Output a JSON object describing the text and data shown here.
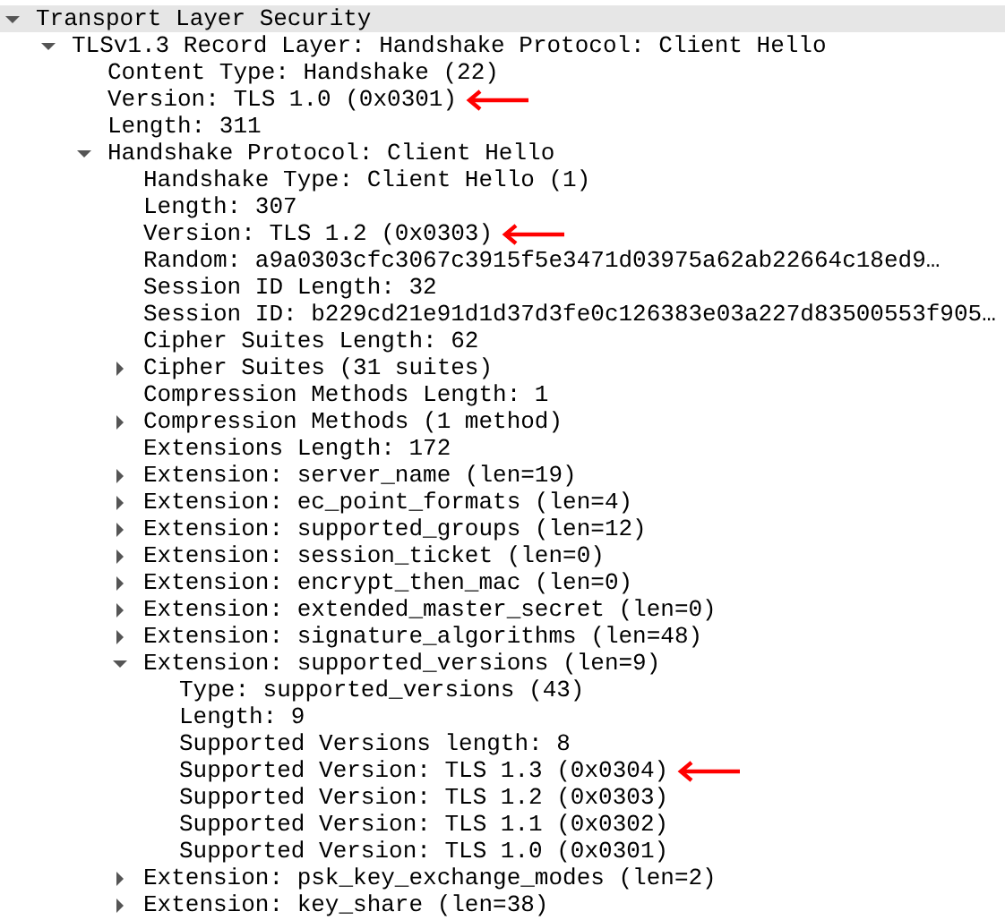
{
  "tree": [
    {
      "label": "Transport Layer Security",
      "selected": true,
      "marked": false,
      "expanded": true,
      "children": [
        {
          "label": "TLSv1.3 Record Layer: Handshake Protocol: Client Hello",
          "selected": false,
          "marked": false,
          "expanded": true,
          "children": [
            {
              "label": "Content Type: Handshake (22)",
              "selected": false,
              "marked": false
            },
            {
              "label": "Version: TLS 1.0 (0x0301)",
              "selected": false,
              "marked": true
            },
            {
              "label": "Length: 311",
              "selected": false,
              "marked": false
            },
            {
              "label": "Handshake Protocol: Client Hello",
              "selected": false,
              "marked": false,
              "expanded": true,
              "children": [
                {
                  "label": "Handshake Type: Client Hello (1)",
                  "selected": false,
                  "marked": false
                },
                {
                  "label": "Length: 307",
                  "selected": false,
                  "marked": false
                },
                {
                  "label": "Version: TLS 1.2 (0x0303)",
                  "selected": false,
                  "marked": true
                },
                {
                  "label": "Random: a9a0303cfc3067c3915f5e3471d03975a62ab22664c18ed9…",
                  "selected": false,
                  "marked": false
                },
                {
                  "label": "Session ID Length: 32",
                  "selected": false,
                  "marked": false
                },
                {
                  "label": "Session ID: b229cd21e91d1d37d3fe0c126383e03a227d83500553f905…",
                  "selected": false,
                  "marked": false
                },
                {
                  "label": "Cipher Suites Length: 62",
                  "selected": false,
                  "marked": false
                },
                {
                  "label": "Cipher Suites (31 suites)",
                  "selected": false,
                  "marked": false,
                  "expanded": false
                },
                {
                  "label": "Compression Methods Length: 1",
                  "selected": false,
                  "marked": false
                },
                {
                  "label": "Compression Methods (1 method)",
                  "selected": false,
                  "marked": false,
                  "expanded": false
                },
                {
                  "label": "Extensions Length: 172",
                  "selected": false,
                  "marked": false
                },
                {
                  "label": "Extension: server_name (len=19)",
                  "selected": false,
                  "marked": false,
                  "expanded": false
                },
                {
                  "label": "Extension: ec_point_formats (len=4)",
                  "selected": false,
                  "marked": false,
                  "expanded": false
                },
                {
                  "label": "Extension: supported_groups (len=12)",
                  "selected": false,
                  "marked": false,
                  "expanded": false
                },
                {
                  "label": "Extension: session_ticket (len=0)",
                  "selected": false,
                  "marked": false,
                  "expanded": false
                },
                {
                  "label": "Extension: encrypt_then_mac (len=0)",
                  "selected": false,
                  "marked": false,
                  "expanded": false
                },
                {
                  "label": "Extension: extended_master_secret (len=0)",
                  "selected": false,
                  "marked": false,
                  "expanded": false
                },
                {
                  "label": "Extension: signature_algorithms (len=48)",
                  "selected": false,
                  "marked": false,
                  "expanded": false
                },
                {
                  "label": "Extension: supported_versions (len=9)",
                  "selected": false,
                  "marked": false,
                  "expanded": true,
                  "children": [
                    {
                      "label": "Type: supported_versions (43)",
                      "selected": false,
                      "marked": false
                    },
                    {
                      "label": "Length: 9",
                      "selected": false,
                      "marked": false
                    },
                    {
                      "label": "Supported Versions length: 8",
                      "selected": false,
                      "marked": false
                    },
                    {
                      "label": "Supported Version: TLS 1.3 (0x0304)",
                      "selected": false,
                      "marked": true
                    },
                    {
                      "label": "Supported Version: TLS 1.2 (0x0303)",
                      "selected": false,
                      "marked": false
                    },
                    {
                      "label": "Supported Version: TLS 1.1 (0x0302)",
                      "selected": false,
                      "marked": false
                    },
                    {
                      "label": "Supported Version: TLS 1.0 (0x0301)",
                      "selected": false,
                      "marked": false
                    }
                  ]
                },
                {
                  "label": "Extension: psk_key_exchange_modes (len=2)",
                  "selected": false,
                  "marked": false,
                  "expanded": false
                },
                {
                  "label": "Extension: key_share (len=38)",
                  "selected": false,
                  "marked": false,
                  "expanded": false
                }
              ]
            }
          ]
        }
      ]
    }
  ]
}
